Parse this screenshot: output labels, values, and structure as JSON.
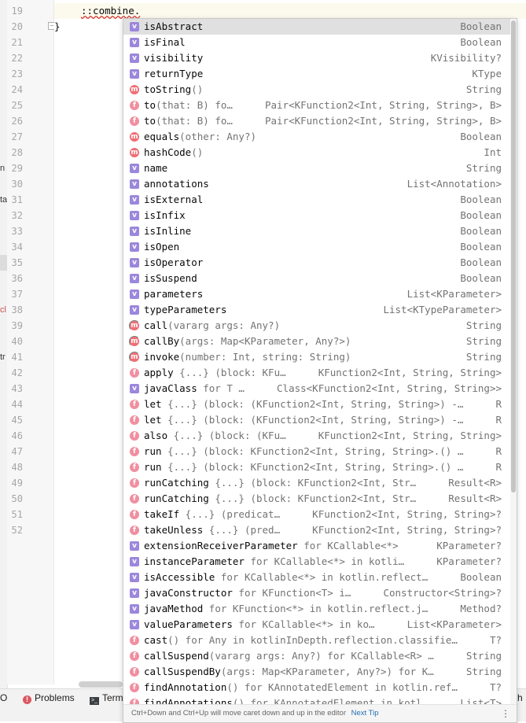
{
  "editor": {
    "line_numbers": [
      "19",
      "20",
      "21",
      "22",
      "23",
      "24",
      "25",
      "26",
      "27",
      "28",
      "29",
      "30",
      "31",
      "32",
      "33",
      "34",
      "35",
      "36",
      "37",
      "38",
      "39",
      "40",
      "41",
      "42",
      "43",
      "44",
      "45",
      "46",
      "47",
      "48",
      "49",
      "50",
      "51",
      "52"
    ],
    "code_line_19": "::combine.",
    "code_line_20": "}"
  },
  "left_strip": {
    "fragments": [
      "n",
      "ta",
      "cl",
      "tr"
    ]
  },
  "completion": {
    "items": [
      {
        "kind": "v",
        "name": "isAbstract",
        "tail": "",
        "type": "Boolean",
        "selected": true
      },
      {
        "kind": "v",
        "name": "isFinal",
        "tail": "",
        "type": "Boolean"
      },
      {
        "kind": "v",
        "name": "visibility",
        "tail": "",
        "type": "KVisibility?"
      },
      {
        "kind": "v",
        "name": "returnType",
        "tail": "",
        "type": "KType"
      },
      {
        "kind": "m",
        "name": "toString",
        "tail": "()",
        "type": "String"
      },
      {
        "kind": "f",
        "name": "to",
        "tail": "(that: B) fo…",
        "type": "Pair<KFunction2<Int, String, String>, B>"
      },
      {
        "kind": "f",
        "name": "to",
        "tail": "(that: B) fo…",
        "type": "Pair<KFunction2<Int, String, String>, B>"
      },
      {
        "kind": "m",
        "name": "equals",
        "tail": "(other: Any?)",
        "type": "Boolean"
      },
      {
        "kind": "m",
        "name": "hashCode",
        "tail": "()",
        "type": "Int"
      },
      {
        "kind": "v",
        "name": "name",
        "tail": "",
        "type": "String"
      },
      {
        "kind": "v",
        "name": "annotations",
        "tail": "",
        "type": "List<Annotation>"
      },
      {
        "kind": "v",
        "name": "isExternal",
        "tail": "",
        "type": "Boolean"
      },
      {
        "kind": "v",
        "name": "isInfix",
        "tail": "",
        "type": "Boolean"
      },
      {
        "kind": "v",
        "name": "isInline",
        "tail": "",
        "type": "Boolean"
      },
      {
        "kind": "v",
        "name": "isOpen",
        "tail": "",
        "type": "Boolean"
      },
      {
        "kind": "v",
        "name": "isOperator",
        "tail": "",
        "type": "Boolean"
      },
      {
        "kind": "v",
        "name": "isSuspend",
        "tail": "",
        "type": "Boolean"
      },
      {
        "kind": "v",
        "name": "parameters",
        "tail": "",
        "type": "List<KParameter>"
      },
      {
        "kind": "v",
        "name": "typeParameters",
        "tail": "",
        "type": "List<KTypeParameter>"
      },
      {
        "kind": "ma",
        "name": "call",
        "tail": "(vararg args: Any?)",
        "type": "String"
      },
      {
        "kind": "ma",
        "name": "callBy",
        "tail": "(args: Map<KParameter, Any?>)",
        "type": "String"
      },
      {
        "kind": "ma",
        "name": "invoke",
        "tail": "(number: Int, string: String)",
        "type": "String"
      },
      {
        "kind": "f",
        "name": "apply",
        "tail": " {...} (block: KFu…",
        "type": "KFunction2<Int, String, String>"
      },
      {
        "kind": "v",
        "name": "javaClass",
        "tail": " for T …",
        "type": "Class<KFunction2<Int, String, String>>"
      },
      {
        "kind": "f",
        "name": "let",
        "tail": " {...} (block: (KFunction2<Int, String, String>) -…",
        "type": "R"
      },
      {
        "kind": "f",
        "name": "let",
        "tail": " {...} (block: (KFunction2<Int, String, String>) -…",
        "type": "R"
      },
      {
        "kind": "f",
        "name": "also",
        "tail": " {...} (block: (KFu…",
        "type": "KFunction2<Int, String, String>"
      },
      {
        "kind": "f",
        "name": "run",
        "tail": " {...} (block: KFunction2<Int, String, String>.() …",
        "type": "R"
      },
      {
        "kind": "f",
        "name": "run",
        "tail": " {...} (block: KFunction2<Int, String, String>.() …",
        "type": "R"
      },
      {
        "kind": "f",
        "name": "runCatching",
        "tail": " {...} (block: KFunction2<Int, Str…",
        "type": "Result<R>"
      },
      {
        "kind": "f",
        "name": "runCatching",
        "tail": " {...} (block: KFunction2<Int, Str…",
        "type": "Result<R>"
      },
      {
        "kind": "f",
        "name": "takeIf",
        "tail": " {...} (predicat…",
        "type": "KFunction2<Int, String, String>?"
      },
      {
        "kind": "f",
        "name": "takeUnless",
        "tail": " {...} (pred…",
        "type": "KFunction2<Int, String, String>?"
      },
      {
        "kind": "v",
        "name": "extensionReceiverParameter",
        "tail": " for KCallable<*>",
        "type": "KParameter?"
      },
      {
        "kind": "v",
        "name": "instanceParameter",
        "tail": " for KCallable<*> in kotli…",
        "type": "KParameter?"
      },
      {
        "kind": "v",
        "name": "isAccessible",
        "tail": " for KCallable<*> in kotlin.reflect…",
        "type": "Boolean"
      },
      {
        "kind": "v",
        "name": "javaConstructor",
        "tail": " for KFunction<T> i…",
        "type": "Constructor<String>?"
      },
      {
        "kind": "v",
        "name": "javaMethod",
        "tail": " for KFunction<*> in kotlin.reflect.j…",
        "type": "Method?"
      },
      {
        "kind": "v",
        "name": "valueParameters",
        "tail": " for KCallable<*> in ko…",
        "type": "List<KParameter>"
      },
      {
        "kind": "f",
        "name": "cast",
        "tail": "() for Any in kotlinInDepth.reflection.classifie…",
        "type": "T?"
      },
      {
        "kind": "f",
        "name": "callSuspend",
        "tail": "(vararg args: Any?) for KCallable<R> …",
        "type": "String"
      },
      {
        "kind": "f",
        "name": "callSuspendBy",
        "tail": "(args: Map<KParameter, Any?>) for K…",
        "type": "String"
      },
      {
        "kind": "f",
        "name": "findAnnotation",
        "tail": "() for KAnnotatedElement in kotlin.ref…",
        "type": "T?"
      },
      {
        "kind": "f",
        "name": "findAnnotations",
        "tail": "() for KAnnotatedElement in kotl…",
        "type": "List<T>"
      }
    ],
    "tip_text": "Ctrl+Down and Ctrl+Up will move caret down and up in the editor",
    "tip_link": "Next Tip",
    "more_icon": "⋮"
  },
  "bottom_bar": {
    "o_label": "O",
    "problems_label": "Problems",
    "terminal_label": "Term",
    "right_fragment": "h",
    "error_icon": "!"
  }
}
